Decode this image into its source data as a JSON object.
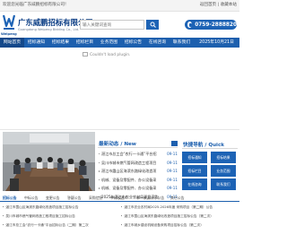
{
  "topbar": {
    "welcome": "欢迎您光临广东威鹏招标有限公司！",
    "links": "返回首页 | 收藏本站"
  },
  "header": {
    "company_name": "广东威鹏招标有限公司",
    "company_en": "Guangdong Weipeng Bidding Co., Ltd.",
    "logo_sub": "Weipeng",
    "search_placeholder": "输入关键词查询",
    "phone": "0759-2888820"
  },
  "nav": {
    "items": [
      {
        "label": "网站首页"
      },
      {
        "label": "招标通知"
      },
      {
        "label": "招标结果"
      },
      {
        "label": "招标栏目"
      },
      {
        "label": "业务范围"
      },
      {
        "label": "招标公告"
      },
      {
        "label": "在线咨询"
      },
      {
        "label": "联系我们"
      },
      {
        "label": "2025年10月21日"
      }
    ]
  },
  "banner": {
    "broken_text": "Couldn't load plugin."
  },
  "news": {
    "title": "最新动态 / New",
    "items": [
      {
        "title": "湛江市总工会“农行一卡通”平台招",
        "date": "09-11"
      },
      {
        "title": "吴川市城市燃气管网改造工程项目",
        "date": "09-11"
      },
      {
        "title": "湛江市霞山区海滨东路绿化改造项",
        "date": "09-11"
      },
      {
        "title": "机械、设备及零配件、办公设备采",
        "date": "09-11"
      },
      {
        "title": "机械、设备及零配件、办公设备采",
        "date": "09-11"
      },
      {
        "title": "2025年湛江市农业农村局项目采购",
        "date": "09-11"
      }
    ]
  },
  "quick": {
    "title": "快捷导航 / Quick",
    "buttons": [
      {
        "label": "招标通知"
      },
      {
        "label": "招标结果"
      },
      {
        "label": "招标栏目"
      },
      {
        "label": "业务范围"
      },
      {
        "label": "在线咨询"
      },
      {
        "label": "联系我们"
      }
    ]
  },
  "tabs": {
    "items": [
      {
        "label": "招标公告"
      },
      {
        "label": "中标公告"
      },
      {
        "label": "变更公告"
      },
      {
        "label": "答疑公告"
      },
      {
        "label": "采购信息"
      },
      {
        "label": "中标候选人"
      },
      {
        "label": "单一来源公示公告"
      },
      {
        "label": "其它公告"
      }
    ]
  },
  "bottom_list": {
    "left": [
      {
        "text": "湛江市霞山区海滨东路绿化改造项目施工招标公告"
      },
      {
        "text": "吴川市城市燃气管网改造工程项目施工招标公告"
      },
      {
        "text": "湛江市总工会“农行一卡通”平台招标公告（二期）第二次"
      }
    ],
    "right": [
      {
        "text": "湛江市农业农村局2025-2026年度 采购项目（第二期）公告"
      },
      {
        "text": "湛江市霞山区海滨东路绿化改造项目施工招标公告（第二次）"
      },
      {
        "text": "湛江市城乡建设机械设备采购项目招标公告（第二次）"
      }
    ]
  },
  "colors": {
    "brand_blue": "#1c5fae",
    "nav_active": "#13488a"
  }
}
